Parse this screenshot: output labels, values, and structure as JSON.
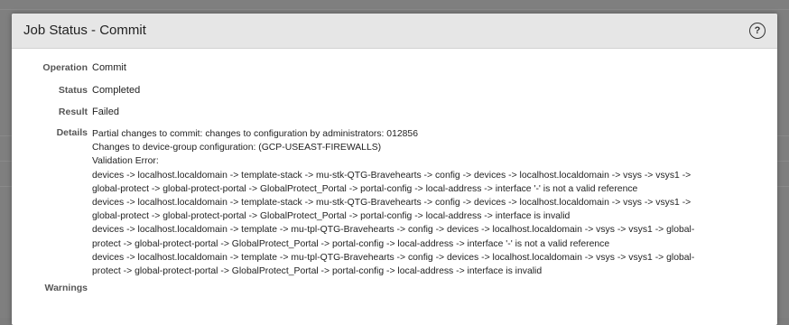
{
  "dialog": {
    "title": "Job Status - Commit",
    "help_icon": "question-circle-icon"
  },
  "fields": {
    "operation_label": "Operation",
    "operation_value": "Commit",
    "status_label": "Status",
    "status_value": "Completed",
    "result_label": "Result",
    "result_value": "Failed",
    "details_label": "Details",
    "warnings_label": "Warnings"
  },
  "details": [
    "Partial changes to commit: changes to configuration by administrators: 012856",
    "Changes to device-group configuration: (GCP-USEAST-FIREWALLS)",
    "Validation Error:",
    "devices -> localhost.localdomain -> template-stack -> mu-stk-QTG-Bravehearts -> config -> devices -> localhost.localdomain -> vsys -> vsys1 ->",
    "global-protect -> global-protect-portal -> GlobalProtect_Portal -> portal-config -> local-address -> interface '-' is not a valid reference",
    "devices -> localhost.localdomain -> template-stack -> mu-stk-QTG-Bravehearts -> config -> devices -> localhost.localdomain -> vsys -> vsys1 ->",
    "global-protect -> global-protect-portal -> GlobalProtect_Portal -> portal-config -> local-address -> interface is invalid",
    "devices -> localhost.localdomain -> template -> mu-tpl-QTG-Bravehearts -> config -> devices -> localhost.localdomain -> vsys -> vsys1 -> global-",
    "protect -> global-protect-portal -> GlobalProtect_Portal -> portal-config -> local-address -> interface '-' is not a valid reference",
    "devices -> localhost.localdomain -> template -> mu-tpl-QTG-Bravehearts -> config -> devices -> localhost.localdomain -> vsys -> vsys1 -> global-",
    "protect -> global-protect-portal -> GlobalProtect_Portal -> portal-config -> local-address -> interface is invalid"
  ]
}
